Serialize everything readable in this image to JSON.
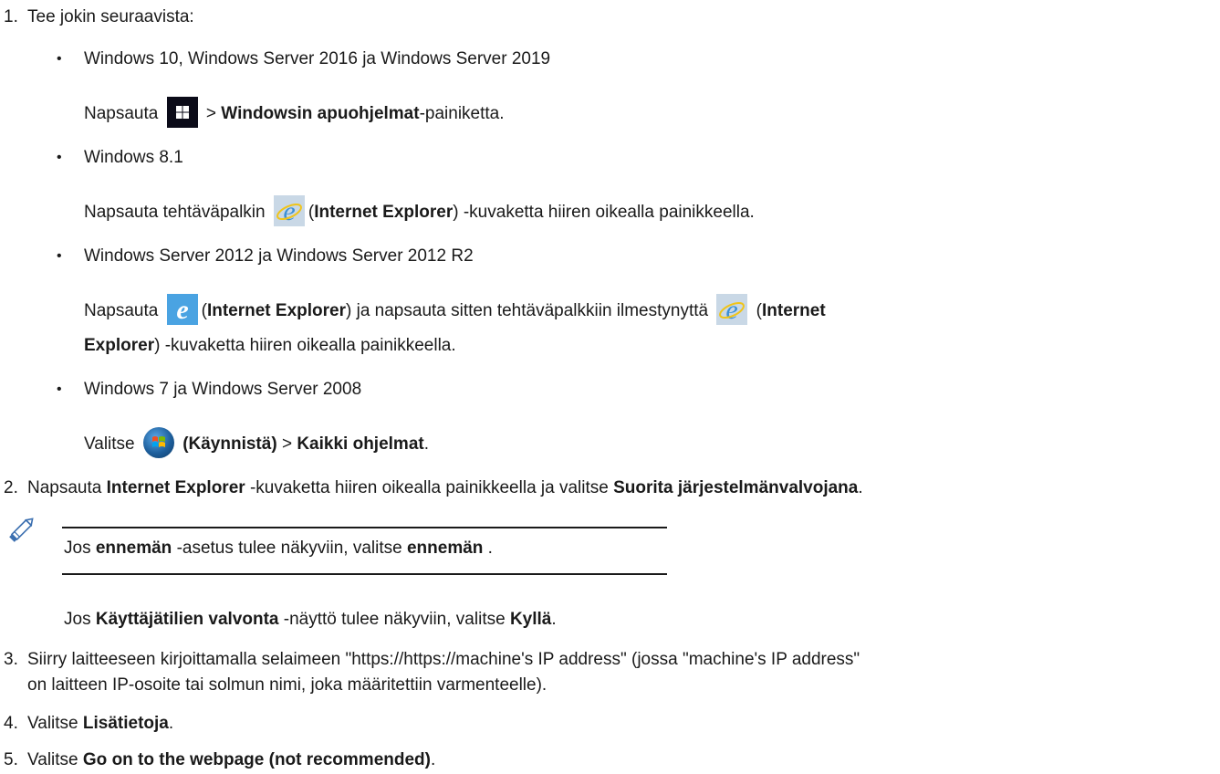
{
  "steps": {
    "s1": {
      "num": "1.",
      "text": "Tee jokin seuraavista:"
    },
    "b1": {
      "title": "Windows 10, Windows Server 2016 ja Windows Server 2019",
      "pre": "Napsauta",
      "gt": ">",
      "bold": "Windowsin apuohjelmat",
      "post": "-painiketta."
    },
    "b2": {
      "title": "Windows 8.1",
      "pre": "Napsauta tehtäväpalkin",
      "paren_open": "(",
      "bold": "Internet Explorer",
      "post": ") -kuvaketta hiiren oikealla painikkeella."
    },
    "b3": {
      "title": "Windows Server 2012 ja Windows Server 2012 R2",
      "pre": "Napsauta",
      "paren_open": "(",
      "bold1": "Internet Explorer",
      "mid": ") ja napsauta sitten tehtäväpalkkiin ilmestynyttä",
      "paren_open2": "(",
      "bold2a": "Internet",
      "bold2b": "Explorer",
      "post": ") -kuvaketta hiiren oikealla painikkeella."
    },
    "b4": {
      "title": "Windows 7 ja Windows Server 2008",
      "pre": "Valitse",
      "bold1": "(Käynnistä)",
      "gt": ">",
      "bold2": "Kaikki ohjelmat",
      "post": "."
    },
    "s2": {
      "num": "2.",
      "pre": "Napsauta",
      "bold1": "Internet Explorer",
      "mid": "-kuvaketta hiiren oikealla painikkeella ja valitse",
      "bold2": "Suorita järjestelmänvalvojana",
      "post": "."
    },
    "note": {
      "pre": "Jos",
      "bold1": "ennemän",
      "mid": "-asetus tulee näkyviin, valitse",
      "bold2": "ennemän",
      "post": "."
    },
    "uac": {
      "pre": "Jos",
      "bold1": "Käyttäjätilien valvonta",
      "mid": "-näyttö tulee näkyviin, valitse",
      "bold2": "Kyllä",
      "post": "."
    },
    "s3": {
      "num": "3.",
      "line1": "Siirry laitteeseen kirjoittamalla selaimeen \"https://https://machine's IP address\" (jossa \"machine's IP address\"",
      "line2": "on laitteen IP-osoite tai solmun nimi, joka määritettiin varmenteelle)."
    },
    "s4": {
      "num": "4.",
      "pre": "Valitse",
      "bold": "Lisätietoja",
      "post": "."
    },
    "s5": {
      "num": "5.",
      "pre": "Valitse",
      "bold": "Go on to the webpage (not recommended)",
      "post": "."
    }
  },
  "icons": {
    "windows": "windows-logo-icon",
    "ie": "internet-explorer-icon",
    "start": "windows7-start-orb-icon",
    "note": "pencil-note-icon"
  },
  "colors": {
    "text": "#1a1a1a",
    "ie_blue": "#4aa3e2",
    "windows_dark": "#0b0b18"
  }
}
